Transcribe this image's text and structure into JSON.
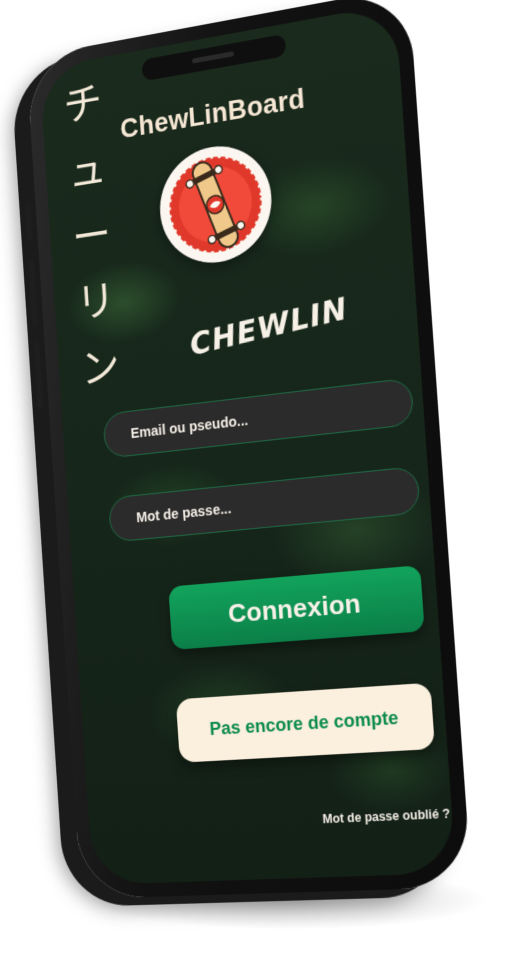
{
  "app": {
    "title": "ChewLinBoard",
    "brand_text": "CHEWLIN",
    "kana_vertical": [
      "チ",
      "ュ",
      "ー",
      "リ",
      "ン"
    ]
  },
  "login": {
    "email_placeholder": "Email ou pseudo...",
    "password_placeholder": "Mot de passe...",
    "connect_label": "Connexion",
    "signup_label": "Pas encore de compte",
    "forgot_label": "Mot de passe oublié ?"
  },
  "logo": {
    "icon": "skateboard-icon"
  },
  "colors": {
    "primary_green": "#0b8a4f",
    "cream": "#f6e7d4",
    "input_bg": "#2b2b2b",
    "logo_red": "#e0392b"
  }
}
